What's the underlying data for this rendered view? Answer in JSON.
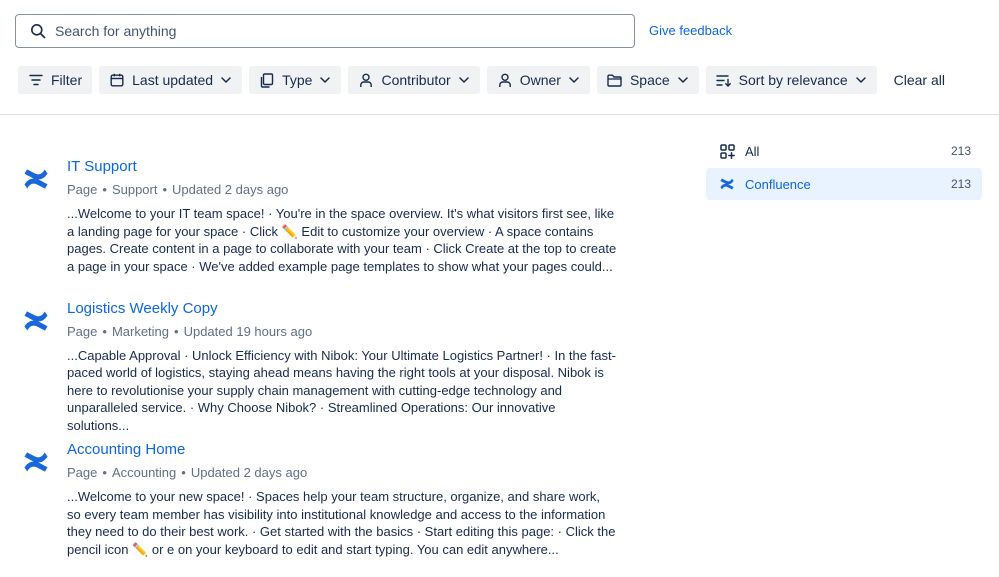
{
  "search": {
    "placeholder": "Search for anything",
    "value": ""
  },
  "feedback_label": "Give feedback",
  "filters": {
    "filter": "Filter",
    "last_updated": "Last updated",
    "type": "Type",
    "contributor": "Contributor",
    "owner": "Owner",
    "space": "Space",
    "sort": "Sort by relevance",
    "clear_all": "Clear all"
  },
  "results": [
    {
      "title": "IT Support",
      "type": "Page",
      "space": "Support",
      "updated": "Updated 2 days ago",
      "excerpt": "...Welcome to your IT team space! · You're in the space overview. It's what visitors first see, like a landing page for your space · Click ✏️ Edit to customize your overview · A space contains pages. Create content in a page to collaborate with your team · Click Create at the top to create a page in your space · We've added example page templates to show what your pages could..."
    },
    {
      "title": "Logistics Weekly Copy",
      "type": "Page",
      "space": "Marketing",
      "updated": "Updated 19 hours ago",
      "excerpt": "...Capable Approval · Unlock Efficiency with Nibok: Your Ultimate Logistics Partner! · In the fast-paced world of logistics, staying ahead means having the right tools at your disposal. Nibok is here to revolutionise your supply chain management with cutting-edge technology and unparalleled service. · Why Choose Nibok? · Streamlined Operations: Our innovative solutions..."
    },
    {
      "title": "Accounting Home",
      "type": "Page",
      "space": "Accounting",
      "updated": "Updated 2 days ago",
      "excerpt": "...Welcome to your new space! · Spaces help your team structure, organize, and share work, so every team member has visibility into institutional knowledge and access to the information they need to do their best work. · Get started with the basics · Start editing this page: · Click the pencil icon ✏️ or e on your keyboard to edit and start typing. You can edit anywhere..."
    }
  ],
  "sidebar": {
    "items": [
      {
        "label": "All",
        "count": "213",
        "icon": "grid-plus-icon"
      },
      {
        "label": "Confluence",
        "count": "213",
        "icon": "confluence-icon"
      }
    ]
  },
  "colors": {
    "link": "#0c66e4",
    "chip_bg": "#f1f2f4",
    "active_bg": "#e9f2ff",
    "confluence": "#1868db"
  }
}
